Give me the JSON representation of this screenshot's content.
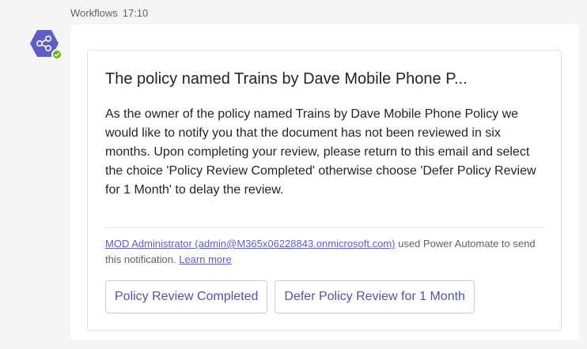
{
  "message": {
    "sender": "Workflows",
    "time": "17:10"
  },
  "avatar": {
    "icon": "share-nodes-icon",
    "color": "#5b5fc7",
    "status": "available",
    "status_color": "#6bb700"
  },
  "card": {
    "title": "The policy named Trains by Dave Mobile Phone P...",
    "body": "As the owner of the policy named Trains by Dave Mobile Phone Policy we would like to notify you that the document has not been reviewed in six months. Upon completing your review, please return to this email and select the choice 'Policy Review Completed' otherwise choose 'Defer Policy Review for 1 Month' to delay the review.",
    "footer": {
      "sender_link": "MOD Administrator (admin@M365x06228843.onmicrosoft.com)",
      "text": " used Power Automate to send this notification. ",
      "learn_more": "Learn more"
    },
    "actions": {
      "primary": "Policy Review Completed",
      "secondary": "Defer Policy Review for 1 Month"
    }
  },
  "colors": {
    "accent": "#5b5fc7",
    "button_text": "#4f52b2",
    "background": "#f5f5f5"
  }
}
